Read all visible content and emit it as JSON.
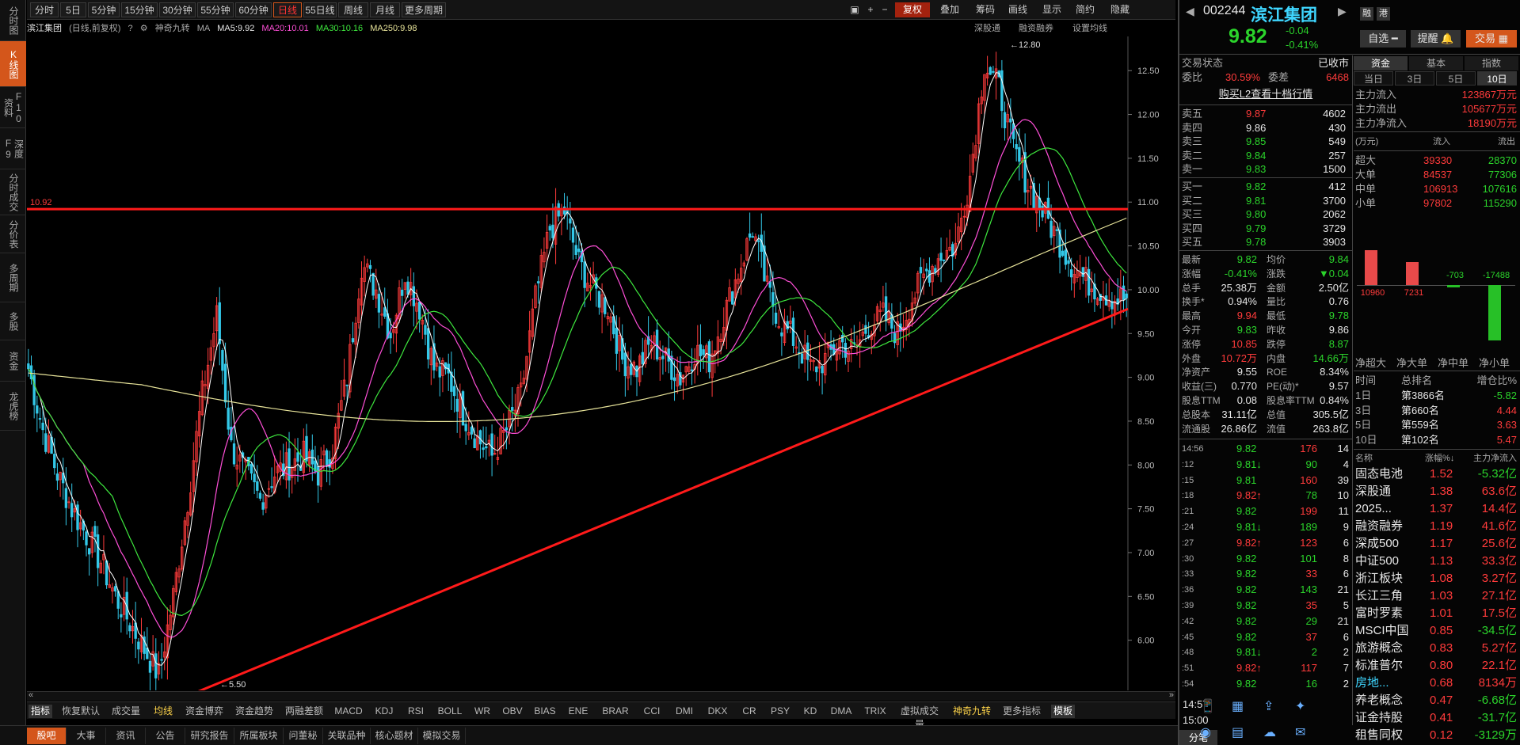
{
  "left_tabs": [
    "分时图",
    "K线图",
    "F10资料",
    "深度F9",
    "分时成交",
    "分价表",
    "多周期",
    "多股",
    "资金",
    "龙虎榜"
  ],
  "period_tabs": [
    "分时",
    "5日",
    "5分钟",
    "15分钟",
    "30分钟",
    "55分钟",
    "60分钟",
    "日线",
    "55日线",
    "周线",
    "月线",
    "更多周期"
  ],
  "active_period": "日线",
  "toolbar": {
    "fuquan": "复权",
    "overlay": "叠加",
    "chouma": "筹码",
    "draw": "画线",
    "display": "显示",
    "simple": "简约",
    "hide": "隐藏"
  },
  "infobar": {
    "name": "滨江集团",
    "mode": "(日线,前复权)",
    "indicator": "神奇九转",
    "ma": "MA",
    "ma5": "MA5:9.92",
    "ma20": "MA20:10.01",
    "ma30": "MA30:10.16",
    "ma250": "MA250:9.98",
    "link1": "深股通",
    "link2": "融资融券",
    "link3": "设置均线"
  },
  "chart_data": {
    "type": "line",
    "yticks": [
      "12.50",
      "12.00",
      "11.50",
      "11.00",
      "10.50",
      "10.00",
      "9.50",
      "9.00",
      "8.50",
      "8.00",
      "7.50",
      "7.00",
      "6.50",
      "6.00"
    ],
    "ylim": [
      5.5,
      12.8
    ],
    "hline_label": "10.92",
    "hline_value": 10.92,
    "high_label": "12.80",
    "low_label": "5.50",
    "close_series": [
      9.1,
      8.4,
      7.9,
      7.5,
      7.2,
      6.9,
      6.5,
      6.2,
      5.9,
      5.6,
      6.5,
      7.6,
      8.8,
      9.7,
      8.2,
      7.9,
      7.6,
      7.9,
      8.0,
      8.1,
      7.9,
      8.2,
      9.0,
      10.3,
      10.0,
      9.5,
      10.2,
      9.8,
      9.1,
      9.0,
      8.6,
      8.3,
      8.1,
      8.4,
      8.8,
      9.9,
      10.7,
      10.9,
      10.3,
      10.0,
      9.8,
      9.2,
      9.1,
      9.4,
      9.2,
      9.0,
      9.3,
      9.2,
      9.7,
      10.2,
      10.7,
      10.0,
      9.6,
      9.4,
      9.1,
      9.2,
      9.4,
      9.3,
      9.6,
      9.7,
      9.5,
      9.9,
      10.2,
      10.4,
      10.5,
      11.3,
      12.6,
      12.3,
      11.6,
      11.2,
      10.9,
      10.6,
      10.3,
      10.1,
      10.0,
      9.9
    ]
  },
  "bottom_indicators": [
    "指标",
    "恢复默认",
    "成交量",
    "均线",
    "资金博弈",
    "资金趋势",
    "两融差额",
    "MACD",
    "KDJ",
    "RSI",
    "BOLL",
    "WR",
    "OBV",
    "BIAS",
    "ENE",
    "BRAR",
    "CCI",
    "DMI",
    "DKX",
    "CR",
    "PSY",
    "KD",
    "DMA",
    "TRIX",
    "虚拟成交量",
    "神奇九转",
    "更多指标",
    "模板"
  ],
  "bottom_tabs": [
    "股吧",
    "大事",
    "资讯",
    "公告",
    "研究报告",
    "所属板块",
    "问董秘",
    "关联品种",
    "核心题材",
    "模拟交易"
  ],
  "stock": {
    "code": "002244",
    "name": "滨江集团",
    "price": "9.82",
    "change": "-0.04",
    "pct": "-0.41%",
    "btn_rong": "融",
    "btn_gang": "港",
    "zixuan": "自选",
    "tixing": "提醒",
    "jiaoyi": "交易"
  },
  "status": {
    "label": "交易状态",
    "value": "已收市",
    "weibi_label": "委比",
    "weibi": "30.59%",
    "weicha_label": "委差",
    "weicha": "6468",
    "buy_l2": "购买L2查看十档行情"
  },
  "asks": [
    [
      "卖五",
      "9.87",
      "4602"
    ],
    [
      "卖四",
      "9.86",
      "430"
    ],
    [
      "卖三",
      "9.85",
      "549"
    ],
    [
      "卖二",
      "9.84",
      "257"
    ],
    [
      "卖一",
      "9.83",
      "1500"
    ]
  ],
  "bids": [
    [
      "买一",
      "9.82",
      "412"
    ],
    [
      "买二",
      "9.81",
      "3700"
    ],
    [
      "买三",
      "9.80",
      "2062"
    ],
    [
      "买四",
      "9.79",
      "3729"
    ],
    [
      "买五",
      "9.78",
      "3903"
    ]
  ],
  "quote": [
    [
      "最新",
      "9.82",
      "均价",
      "9.84"
    ],
    [
      "涨幅",
      "-0.41%",
      "涨跌",
      "▼0.04"
    ],
    [
      "总手",
      "25.38万",
      "金额",
      "2.50亿"
    ],
    [
      "换手*",
      "0.94%",
      "量比",
      "0.76"
    ],
    [
      "最高",
      "9.94",
      "最低",
      "9.78"
    ],
    [
      "今开",
      "9.83",
      "昨收",
      "9.86"
    ],
    [
      "涨停",
      "10.85",
      "跌停",
      "8.87"
    ],
    [
      "外盘",
      "10.72万",
      "内盘",
      "14.66万"
    ],
    [
      "净资产",
      "9.55",
      "ROE",
      "8.34%"
    ],
    [
      "收益(三)",
      "0.770",
      "PE(动)*",
      "9.57"
    ],
    [
      "股息TTM",
      "0.08",
      "股息率TTM",
      "0.84%"
    ],
    [
      "总股本",
      "31.11亿",
      "总值",
      "305.5亿"
    ],
    [
      "流通股",
      "26.86亿",
      "流值",
      "263.8亿"
    ]
  ],
  "ticks": [
    [
      "14:56",
      "9.82",
      "176",
      "14"
    ],
    [
      ":12",
      "9.81↓",
      "90",
      "4"
    ],
    [
      ":15",
      "9.81",
      "160",
      "39"
    ],
    [
      ":18",
      "9.82↑",
      "78",
      "10"
    ],
    [
      ":21",
      "9.82",
      "199",
      "11"
    ],
    [
      ":24",
      "9.81↓",
      "189",
      "9"
    ],
    [
      ":27",
      "9.82↑",
      "123",
      "6"
    ],
    [
      ":30",
      "9.82",
      "101",
      "8"
    ],
    [
      ":33",
      "9.82",
      "33",
      "6"
    ],
    [
      ":36",
      "9.82",
      "143",
      "21"
    ],
    [
      ":39",
      "9.82",
      "35",
      "5"
    ],
    [
      ":42",
      "9.82",
      "29",
      "21"
    ],
    [
      ":45",
      "9.82",
      "37",
      "6"
    ],
    [
      ":48",
      "9.81↓",
      "2",
      "2"
    ],
    [
      ":51",
      "9.82↑",
      "117",
      "7"
    ],
    [
      ":54",
      "9.82",
      "16",
      "2"
    ]
  ],
  "tick_times": [
    "14:57",
    "15:00"
  ],
  "fenbi": "分笔",
  "fund_tabs": [
    "资金",
    "基本",
    "指数"
  ],
  "day_tabs": [
    "当日",
    "3日",
    "5日",
    "10日"
  ],
  "flows": [
    [
      "主力流入",
      "123867万元"
    ],
    [
      "主力流出",
      "105677万元"
    ],
    [
      "主力净流入",
      "18190万元"
    ]
  ],
  "flow_head": [
    "(万元)",
    "流入",
    "流出"
  ],
  "flow_rows": [
    [
      "超大",
      "39330",
      "28370"
    ],
    [
      "大单",
      "84537",
      "77306"
    ],
    [
      "中单",
      "106913",
      "107616"
    ],
    [
      "小单",
      "97802",
      "115290"
    ]
  ],
  "net_bars": {
    "labels": [
      "净超大",
      "净大单",
      "净中单",
      "净小单"
    ],
    "values": [
      10960,
      7231,
      -703,
      -17488
    ],
    "texts": [
      "10960",
      "7231",
      "-703",
      "-17488"
    ]
  },
  "rank_head": [
    "时间",
    "总排名",
    "增仓比%"
  ],
  "ranks": [
    [
      "1日",
      "第3866名",
      "-5.82"
    ],
    [
      "3日",
      "第660名",
      "4.44"
    ],
    [
      "5日",
      "第559名",
      "3.63"
    ],
    [
      "10日",
      "第102名",
      "5.47"
    ]
  ],
  "sector_head": [
    "名称",
    "涨幅%↓",
    "主力净流入"
  ],
  "sectors": [
    [
      "固态电池",
      "1.52",
      "-5.32亿"
    ],
    [
      "深股通",
      "1.38",
      "63.6亿"
    ],
    [
      "2025...",
      "1.37",
      "14.4亿"
    ],
    [
      "融资融券",
      "1.19",
      "41.6亿"
    ],
    [
      "深成500",
      "1.17",
      "25.6亿"
    ],
    [
      "中证500",
      "1.13",
      "33.3亿"
    ],
    [
      "浙江板块",
      "1.08",
      "3.27亿"
    ],
    [
      "长江三角",
      "1.03",
      "27.1亿"
    ],
    [
      "富时罗素",
      "1.01",
      "17.5亿"
    ],
    [
      "MSCI中国",
      "0.85",
      "-34.5亿"
    ],
    [
      "旅游概念",
      "0.83",
      "5.27亿"
    ],
    [
      "标准普尔",
      "0.80",
      "22.1亿"
    ],
    [
      "房地...",
      "0.68",
      "8134万"
    ],
    [
      "养老概念",
      "0.47",
      "-6.68亿"
    ],
    [
      "证金持股",
      "0.41",
      "-31.7亿"
    ],
    [
      "租售同权",
      "0.12",
      "-3129万"
    ]
  ],
  "time_now": "14:57"
}
